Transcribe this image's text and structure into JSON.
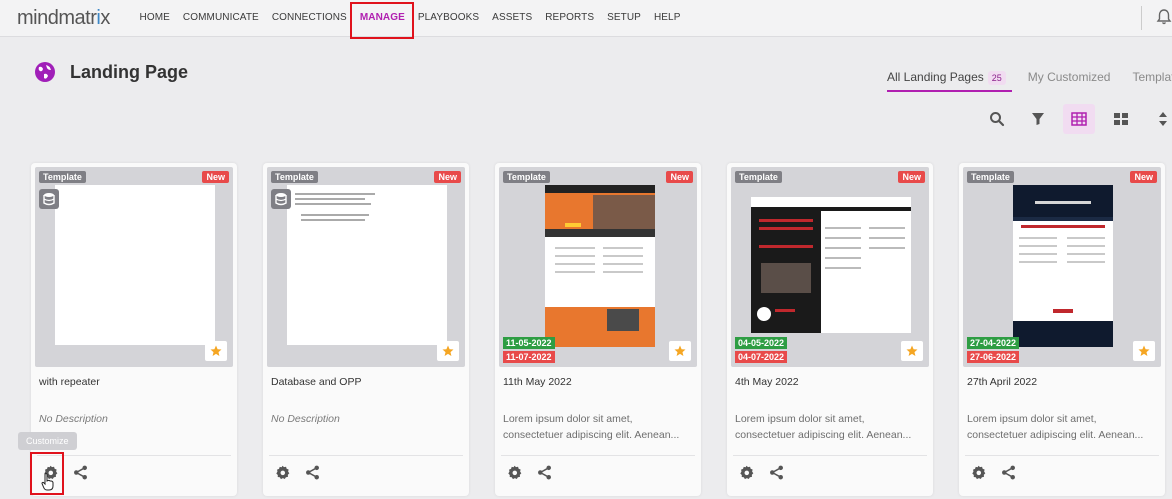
{
  "app": {
    "logo": "mindmatrix"
  },
  "nav": {
    "items": [
      "HOME",
      "COMMUNICATE",
      "CONNECTIONS",
      "MANAGE",
      "PLAYBOOKS",
      "ASSETS",
      "REPORTS",
      "SETUP",
      "HELP"
    ],
    "active": "MANAGE"
  },
  "header": {
    "title": "Landing Page",
    "icon": "globe-icon"
  },
  "tabs": [
    {
      "label": "All Landing Pages",
      "count": "25",
      "active": true
    },
    {
      "label": "My Customized"
    },
    {
      "label": "Templates"
    }
  ],
  "toolbar": {
    "icons": [
      "search-icon",
      "filter-icon",
      "list-view-icon",
      "grid-view-icon",
      "sort-icon"
    ],
    "active": "list-view-icon"
  },
  "labels": {
    "template": "Template",
    "new": "New",
    "customize_tooltip": "Customize"
  },
  "colors": {
    "accent": "#b01fb0",
    "new_badge": "#e84a4a",
    "start_date": "#2e9d43",
    "highlight": "#e0121c"
  },
  "cards": [
    {
      "title": "with repeater",
      "description": "No Description",
      "start_date": "",
      "end_date": ""
    },
    {
      "title": "Database and OPP",
      "description": "No Description",
      "start_date": "",
      "end_date": ""
    },
    {
      "title": "11th May 2022",
      "description": "Lorem ipsum dolor sit amet, consectetuer adipiscing elit. Aenean...",
      "start_date": "11-05-2022",
      "end_date": "11-07-2022"
    },
    {
      "title": "4th May 2022",
      "description": "Lorem ipsum dolor sit amet, consectetuer adipiscing elit. Aenean...",
      "start_date": "04-05-2022",
      "end_date": "04-07-2022"
    },
    {
      "title": "27th April 2022",
      "description": "Lorem ipsum dolor sit amet, consectetuer adipiscing elit. Aenean...",
      "start_date": "27-04-2022",
      "end_date": "27-06-2022"
    }
  ]
}
